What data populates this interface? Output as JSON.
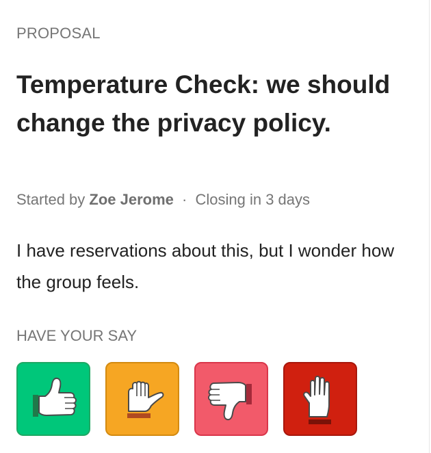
{
  "proposal": {
    "eyebrow": "PROPOSAL",
    "title": "Temperature Check: we should change the privacy policy.",
    "started_by_label": "Started by",
    "author": "Zoe Jerome",
    "separator": "·",
    "closing": "Closing in 3 days",
    "description": "I have reservations about this, but I wonder how the group feels."
  },
  "voting": {
    "heading": "HAVE YOUR SAY",
    "options": [
      {
        "icon": "thumbs-up-icon",
        "color": "#00c77a",
        "border": "#1ea864"
      },
      {
        "icon": "thumb-sideways-icon",
        "color": "#f6a623",
        "border": "#d38a10"
      },
      {
        "icon": "thumbs-down-icon",
        "color": "#f25a6a",
        "border": "#d9364a"
      },
      {
        "icon": "raised-hand-icon",
        "color": "#d0200f",
        "border": "#a8170c"
      }
    ]
  }
}
